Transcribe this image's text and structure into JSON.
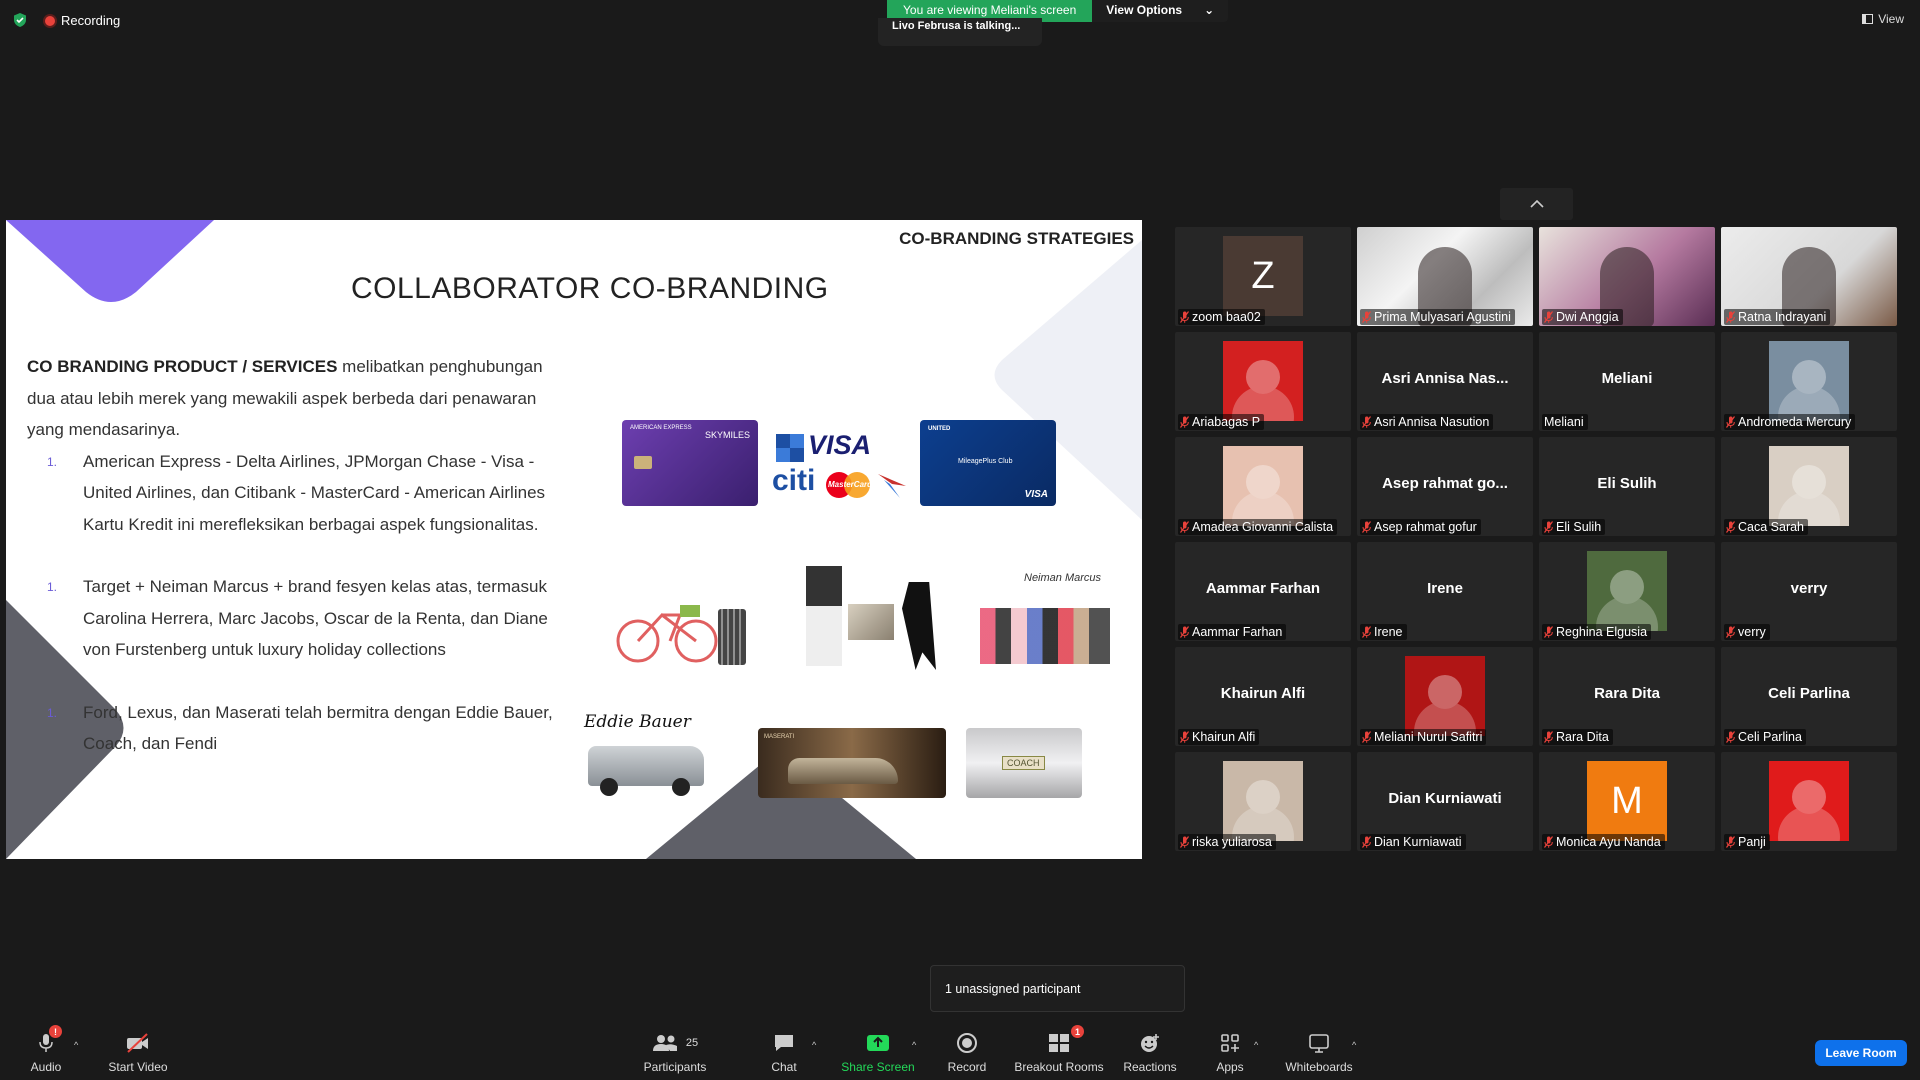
{
  "top": {
    "recording_label": "Recording",
    "viewing_banner": "You are viewing Meliani's screen",
    "view_options": "View Options",
    "talking": "Livo Februsa is talking...",
    "view_label": "View"
  },
  "slide": {
    "header": "CO-BRANDING STRATEGIES",
    "title": "COLLABORATOR CO-BRANDING",
    "intro_bold": "CO BRANDING PRODUCT / SERVICES",
    "intro_rest": " melibatkan penghubungan dua atau lebih merek yang mewakili aspek berbeda dari penawaran yang mendasarinya.",
    "items": [
      {
        "num": "1.",
        "text": "American Express - Delta Airlines, JPMorgan Chase - Visa - United Airlines, dan Citibank - MasterCard - American Airlines Kartu Kredit ini merefleksikan berbagai aspek fungsionalitas."
      },
      {
        "num": "1.",
        "text": "Target + Neiman Marcus + brand fesyen kelas atas, termasuk Carolina Herrera, Marc Jacobs, Oscar de la Renta, dan Diane von Furstenberg untuk luxury holiday collections"
      },
      {
        "num": "1.",
        "text": "Ford, Lexus, dan Maserati telah bermitra dengan Eddie Bauer, Coach, dan Fendi"
      }
    ],
    "card_amex_top": "AMERICAN EXPRESS",
    "card_amex_brand": "SKYMILES",
    "card_visa_text": "VISA",
    "card_citi_text": "citi",
    "card_mc_text": "MasterCard",
    "card_united_top": "UNITED",
    "card_united_mid": "MileagePlus Club",
    "card_united_visa": "VISA",
    "neiman_text": "Neiman Marcus",
    "eddie_text": "Eddie Bauer",
    "maserati_text": "MASERATI",
    "coach_text": "COACH"
  },
  "participants": [
    {
      "name": "zoom baa02",
      "display": "letter",
      "letter": "Z",
      "color": "#4a3a33"
    },
    {
      "name": "Prima Mulyasari Agustini",
      "display": "video"
    },
    {
      "name": "Dwi Anggia",
      "display": "video"
    },
    {
      "name": "Ratna Indrayani",
      "display": "video"
    },
    {
      "name": "Ariabagas P",
      "display": "avatar",
      "color": "#d32020"
    },
    {
      "name": "Asri Annisa Nasution",
      "display": "text",
      "big": "Asri Annisa Nas..."
    },
    {
      "name": "Meliani",
      "display": "text",
      "big": "Meliani",
      "no_mute": true
    },
    {
      "name": "Andromeda Mercury",
      "display": "avatar",
      "color": "#7a8ea0"
    },
    {
      "name": "Amadea Giovanni Calista",
      "display": "avatar",
      "color": "#e7c1b0"
    },
    {
      "name": "Asep rahmat gofur",
      "display": "text",
      "big": "Asep rahmat go..."
    },
    {
      "name": "Eli Sulih",
      "display": "text",
      "big": "Eli Sulih"
    },
    {
      "name": "Caca Sarah",
      "display": "avatar",
      "color": "#d9cfc4"
    },
    {
      "name": "Aammar Farhan",
      "display": "text",
      "big": "Aammar Farhan"
    },
    {
      "name": "Irene",
      "display": "text",
      "big": "Irene"
    },
    {
      "name": "Reghina Elgusia",
      "display": "avatar",
      "color": "#4f6a3e"
    },
    {
      "name": "verry",
      "display": "text",
      "big": "verry"
    },
    {
      "name": "Khairun Alfi",
      "display": "text",
      "big": "Khairun Alfi"
    },
    {
      "name": "Meliani Nurul Safitri",
      "display": "avatar",
      "color": "#b01515"
    },
    {
      "name": "Rara Dita",
      "display": "text",
      "big": "Rara Dita"
    },
    {
      "name": "Celi Parlina",
      "display": "text",
      "big": "Celi Parlina"
    },
    {
      "name": "riska yuliarosa",
      "display": "avatar",
      "color": "#c9b8a8"
    },
    {
      "name": "Dian Kurniawati",
      "display": "text",
      "big": "Dian Kurniawati"
    },
    {
      "name": "Monica Ayu Nanda",
      "display": "letter",
      "letter": "M",
      "color": "#f07b10"
    },
    {
      "name": "Panji",
      "display": "avatar",
      "color": "#e01b1b"
    }
  ],
  "toolbar": {
    "audio": "Audio",
    "audio_badge": "!",
    "start_video": "Start Video",
    "participants": "Participants",
    "participants_count": "25",
    "chat": "Chat",
    "share_screen": "Share Screen",
    "record": "Record",
    "breakout_rooms": "Breakout Rooms",
    "breakout_badge": "1",
    "reactions": "Reactions",
    "apps": "Apps",
    "whiteboards": "Whiteboards",
    "leave_room": "Leave Room",
    "unassigned": "1 unassigned participant"
  },
  "colors": {
    "accent_purple": "#8367f0",
    "share_green": "#23d959",
    "leave_blue": "#0e71eb",
    "mute_red": "#e8423b"
  }
}
